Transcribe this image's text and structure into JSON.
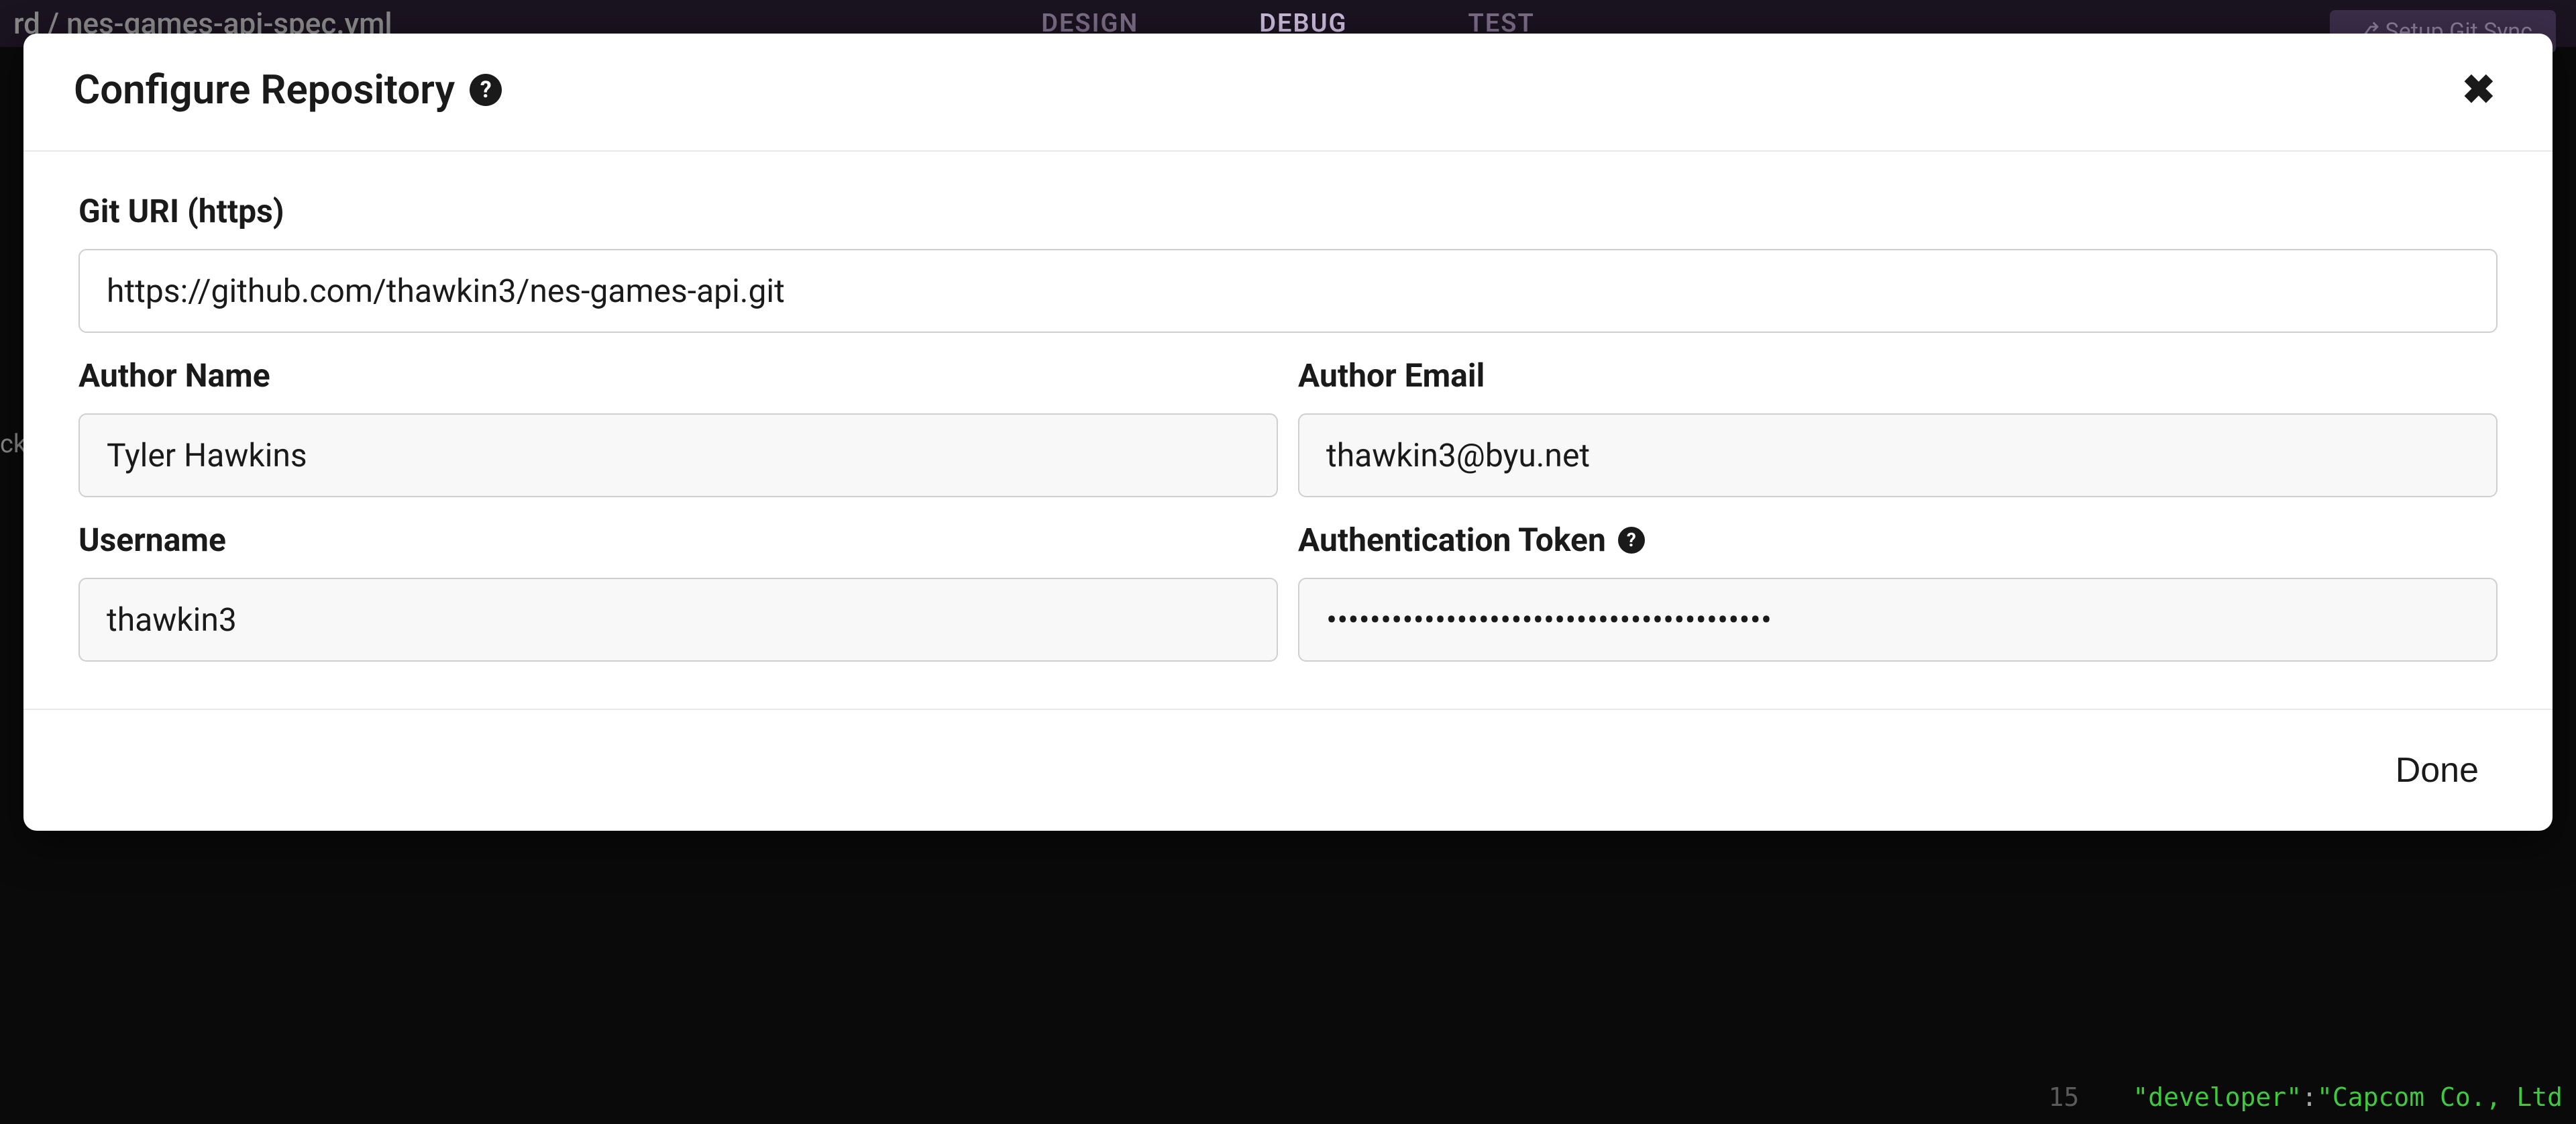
{
  "background": {
    "filename": "rd / nes-games-api-spec.yml",
    "tabs": {
      "design": "DESIGN",
      "debug": "DEBUG",
      "test": "TEST"
    },
    "gitSyncLabel": "⎇  Setup Git Sync",
    "code": {
      "lineNumber": "15",
      "key": "\"developer\"",
      "colon": ": ",
      "value": "\"Capcom Co., Ltd"
    },
    "leftFragment": "ck"
  },
  "modal": {
    "title": "Configure Repository",
    "helpGlyph": "?",
    "closeGlyph": "✖",
    "fields": {
      "gitUri": {
        "label": "Git URI (https)",
        "value": "https://github.com/thawkin3/nes-games-api.git"
      },
      "authorName": {
        "label": "Author Name",
        "value": "Tyler Hawkins"
      },
      "authorEmail": {
        "label": "Author Email",
        "value": "thawkin3@byu.net"
      },
      "username": {
        "label": "Username",
        "value": "thawkin3"
      },
      "authToken": {
        "label": "Authentication Token",
        "value": "•••••••••••••••••••••••••••••••••••••••••"
      }
    },
    "doneLabel": "Done"
  }
}
